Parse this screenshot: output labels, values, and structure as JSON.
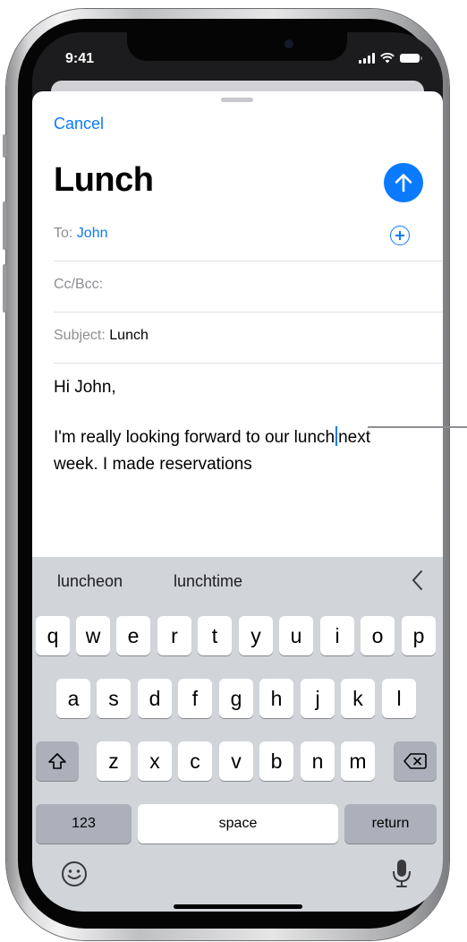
{
  "status_bar": {
    "time": "9:41"
  },
  "compose": {
    "cancel_label": "Cancel",
    "title": "Lunch",
    "to_label": "To:",
    "to_value": "John",
    "cc_label": "Cc/Bcc:",
    "subject_label": "Subject:",
    "subject_value": "Lunch",
    "body_line1": "Hi John,",
    "body_line2_before_cursor": "I'm really looking forward to our lunch",
    "body_line2_after_cursor": "next",
    "body_line3": "week. I made reservations",
    "accent_color": "#0a7aff"
  },
  "keyboard": {
    "predictions": [
      "luncheon",
      "lunchtime"
    ],
    "row1": [
      "q",
      "w",
      "e",
      "r",
      "t",
      "y",
      "u",
      "i",
      "o",
      "p"
    ],
    "row2": [
      "a",
      "s",
      "d",
      "f",
      "g",
      "h",
      "j",
      "k",
      "l"
    ],
    "row3": [
      "z",
      "x",
      "c",
      "v",
      "b",
      "n",
      "m"
    ],
    "numbers_label": "123",
    "space_label": "space",
    "return_label": "return",
    "icons": [
      "shift-icon",
      "delete-icon",
      "emoji-icon",
      "microphone-icon",
      "chevron-left-icon"
    ]
  }
}
